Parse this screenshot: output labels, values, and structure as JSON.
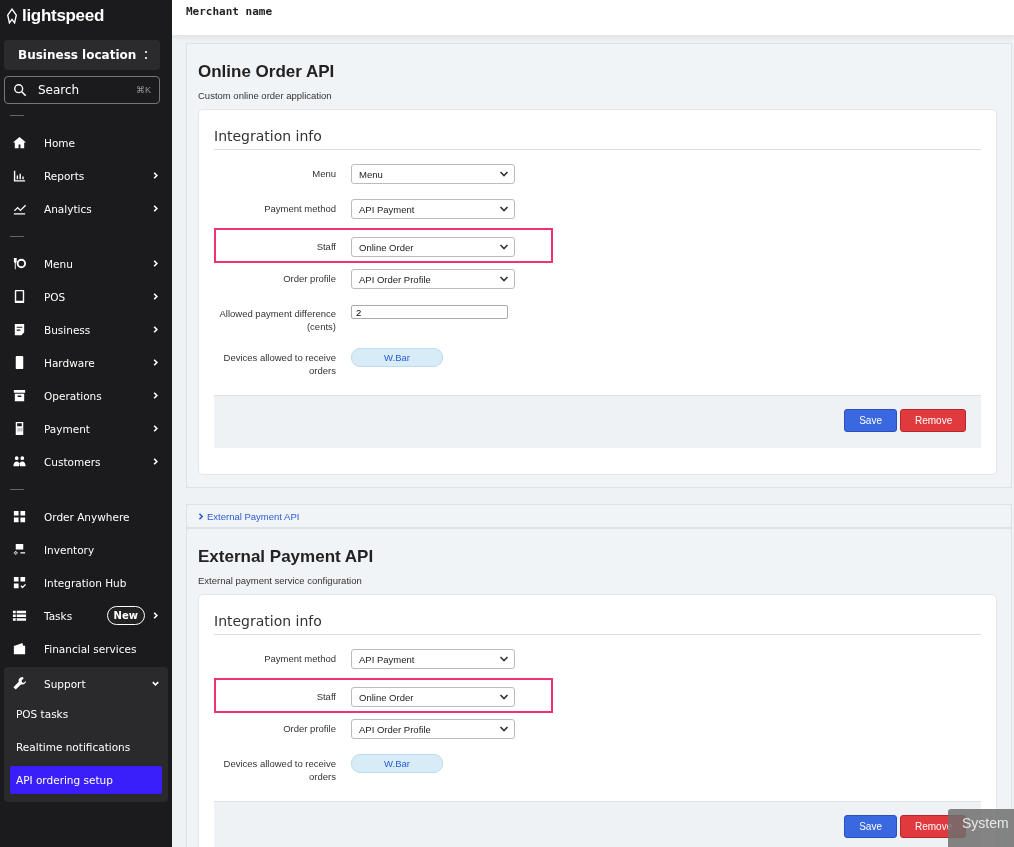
{
  "header": {
    "title": "Merchant name"
  },
  "sidebar": {
    "logo": "lightspeed",
    "location": "Business location",
    "search": {
      "placeholder": "Search",
      "shortcut": "⌘K"
    },
    "groups": [
      [
        {
          "label": "Home",
          "has_submenu": false
        },
        {
          "label": "Reports",
          "has_submenu": true
        },
        {
          "label": "Analytics",
          "has_submenu": true
        }
      ],
      [
        {
          "label": "Menu",
          "has_submenu": true
        },
        {
          "label": "POS",
          "has_submenu": true
        },
        {
          "label": "Business",
          "has_submenu": true
        },
        {
          "label": "Hardware",
          "has_submenu": true
        },
        {
          "label": "Operations",
          "has_submenu": true
        },
        {
          "label": "Payment",
          "has_submenu": true
        },
        {
          "label": "Customers",
          "has_submenu": true
        }
      ],
      [
        {
          "label": "Order Anywhere",
          "has_submenu": false
        },
        {
          "label": "Inventory",
          "has_submenu": false
        },
        {
          "label": "Integration Hub",
          "has_submenu": false
        },
        {
          "label": "Tasks",
          "has_submenu": true,
          "badge": "New"
        },
        {
          "label": "Financial services",
          "has_submenu": false
        },
        {
          "label": "Support",
          "has_submenu": true,
          "expanded": true,
          "children": [
            {
              "label": "POS tasks",
              "selected": false
            },
            {
              "label": "Realtime notifications",
              "selected": false
            },
            {
              "label": "API ordering setup",
              "selected": true
            }
          ]
        }
      ]
    ]
  },
  "sections": [
    {
      "kind": "panel",
      "title": "Online Order API",
      "subtitle": "Custom online order application",
      "card_title": "Integration info",
      "fields": [
        {
          "label": "Menu",
          "kind": "select",
          "value": "Menu",
          "highlighted": false
        },
        {
          "label": "Payment method",
          "kind": "select",
          "value": "API Payment",
          "highlighted": false
        },
        {
          "label": "Staff",
          "kind": "select",
          "value": "Online Order",
          "highlighted": true
        },
        {
          "label": "Order profile",
          "kind": "select",
          "value": "API Order Profile",
          "highlighted": false
        },
        {
          "label": "Allowed payment difference (cents)",
          "kind": "text",
          "value": "2",
          "highlighted": false
        },
        {
          "label": "Devices allowed to receive orders",
          "kind": "tag",
          "value": "W.Bar",
          "highlighted": false
        }
      ],
      "buttons": [
        "Save",
        "Remove"
      ]
    },
    {
      "kind": "collapsed",
      "title": "External Payment API"
    },
    {
      "kind": "panel",
      "title": "External Payment API",
      "subtitle": "External payment service configuration",
      "card_title": "Integration info",
      "fields": [
        {
          "label": "Payment method",
          "kind": "select",
          "value": "API Payment",
          "highlighted": false
        },
        {
          "label": "Staff",
          "kind": "select",
          "value": "Online Order",
          "highlighted": true
        },
        {
          "label": "Order profile",
          "kind": "select",
          "value": "API Order Profile",
          "highlighted": false
        },
        {
          "label": "Devices allowed to receive orders",
          "kind": "tag",
          "value": "W.Bar",
          "highlighted": false
        }
      ],
      "buttons": [
        "Save",
        "Remove"
      ]
    }
  ],
  "tooltip": {
    "text": "System"
  }
}
